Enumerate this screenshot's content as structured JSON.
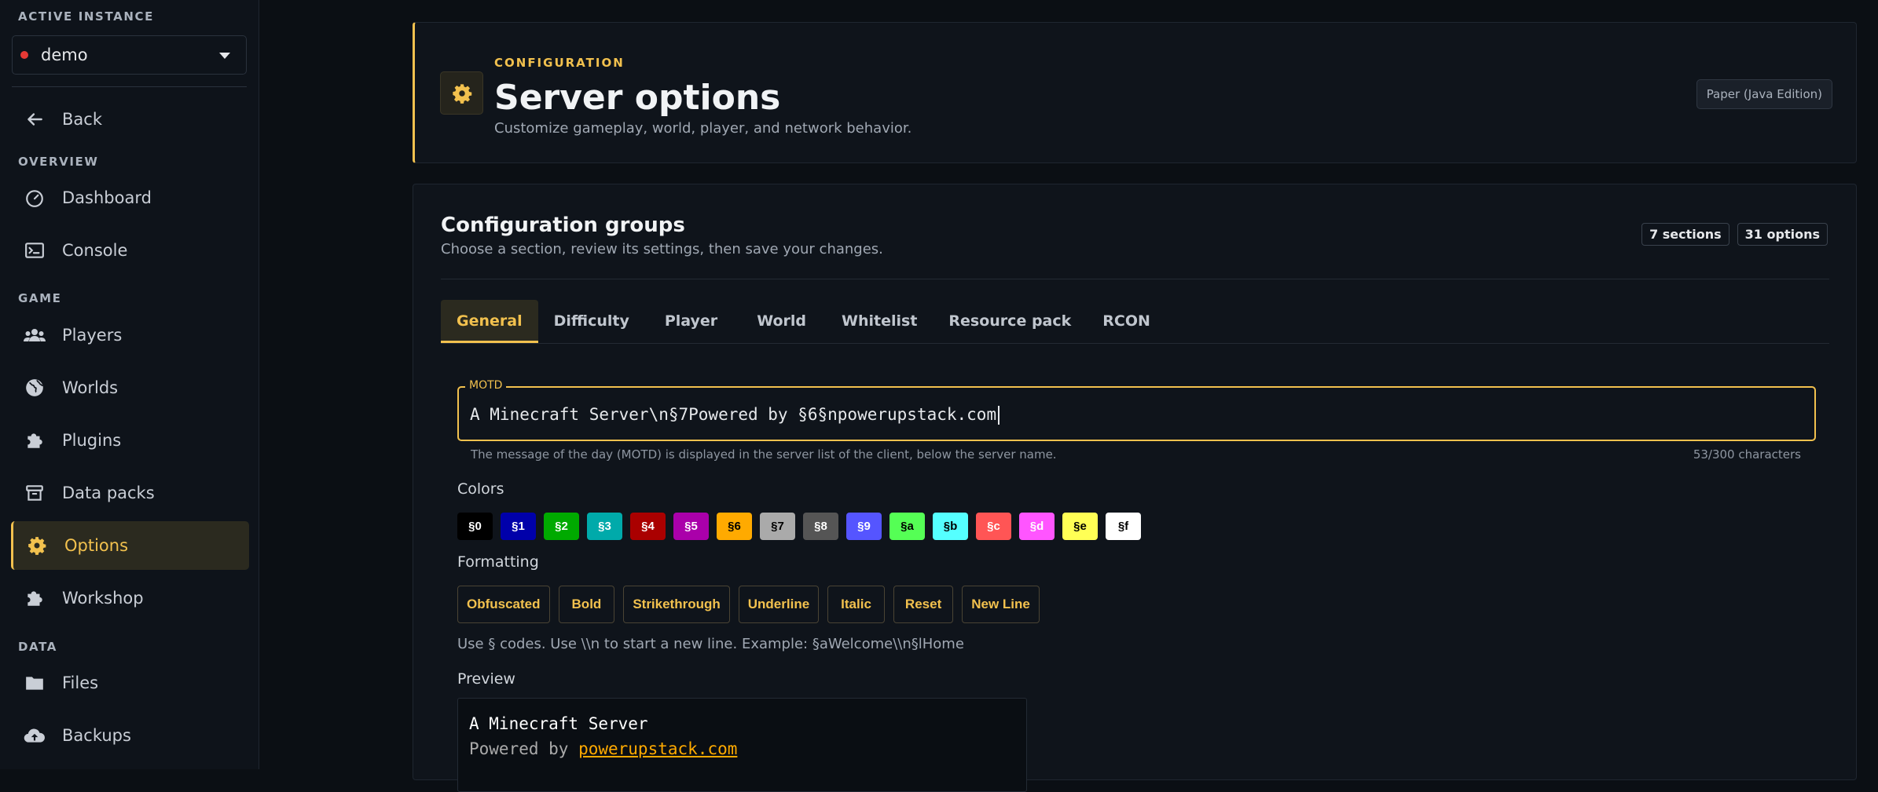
{
  "sidebar": {
    "active_instance_label": "ACTIVE INSTANCE",
    "instance_name": "demo",
    "back_label": "Back",
    "sections": {
      "overview": "OVERVIEW",
      "game": "GAME",
      "data": "DATA"
    },
    "items": {
      "dashboard": "Dashboard",
      "console": "Console",
      "players": "Players",
      "worlds": "Worlds",
      "plugins": "Plugins",
      "datapacks": "Data packs",
      "options": "Options",
      "workshop": "Workshop",
      "files": "Files",
      "backups": "Backups"
    },
    "active_item": "Options"
  },
  "header": {
    "eyebrow": "CONFIGURATION",
    "title": "Server options",
    "subtitle": "Customize gameplay, world, player, and network behavior.",
    "edition": "Paper (Java Edition)"
  },
  "groups": {
    "title": "Configuration groups",
    "subtitle": "Choose a section, review its settings, then save your changes.",
    "sections_count": "7 sections",
    "options_count": "31 options",
    "tabs": [
      "General",
      "Difficulty",
      "Player",
      "World",
      "Whitelist",
      "Resource pack",
      "RCON"
    ],
    "active_tab": "General"
  },
  "motd": {
    "label": "MOTD",
    "value": "A Minecraft Server\\n§7Powered by §6§npowerupstack.com",
    "helper": "The message of the day (MOTD) is displayed in the server list of the client, below the server name.",
    "char_count": "53/300 characters"
  },
  "colors": {
    "label": "Colors",
    "codes": [
      {
        "code": "§0",
        "bg": "#000000",
        "fg": "#ffffff"
      },
      {
        "code": "§1",
        "bg": "#0000aa",
        "fg": "#ffffff"
      },
      {
        "code": "§2",
        "bg": "#00aa00",
        "fg": "#ffffff"
      },
      {
        "code": "§3",
        "bg": "#00aaaa",
        "fg": "#ffffff"
      },
      {
        "code": "§4",
        "bg": "#aa0000",
        "fg": "#ffffff"
      },
      {
        "code": "§5",
        "bg": "#aa00aa",
        "fg": "#ffffff"
      },
      {
        "code": "§6",
        "bg": "#ffaa00",
        "fg": "#000000"
      },
      {
        "code": "§7",
        "bg": "#aaaaaa",
        "fg": "#000000"
      },
      {
        "code": "§8",
        "bg": "#555555",
        "fg": "#ffffff"
      },
      {
        "code": "§9",
        "bg": "#5555ff",
        "fg": "#ffffff"
      },
      {
        "code": "§a",
        "bg": "#55ff55",
        "fg": "#000000"
      },
      {
        "code": "§b",
        "bg": "#55ffff",
        "fg": "#000000"
      },
      {
        "code": "§c",
        "bg": "#ff5555",
        "fg": "#ffffff"
      },
      {
        "code": "§d",
        "bg": "#ff55ff",
        "fg": "#ffffff"
      },
      {
        "code": "§e",
        "bg": "#ffff55",
        "fg": "#000000"
      },
      {
        "code": "§f",
        "bg": "#ffffff",
        "fg": "#000000"
      }
    ]
  },
  "formatting": {
    "label": "Formatting",
    "buttons": [
      "Obfuscated",
      "Bold",
      "Strikethrough",
      "Underline",
      "Italic",
      "Reset",
      "New Line"
    ]
  },
  "hint": "Use § codes. Use \\\\n to start a new line. Example: §aWelcome\\\\n§lHome",
  "preview": {
    "label": "Preview",
    "line1": "A Minecraft Server",
    "line2_prefix": "Powered by ",
    "line2_link": "powerupstack.com",
    "line1_color": "#ffffff",
    "line2_color": "#aaaaaa",
    "link_color": "#ffaa00"
  },
  "theme": {
    "accent": "#f2c14e",
    "teal": "#2fb7a6"
  }
}
